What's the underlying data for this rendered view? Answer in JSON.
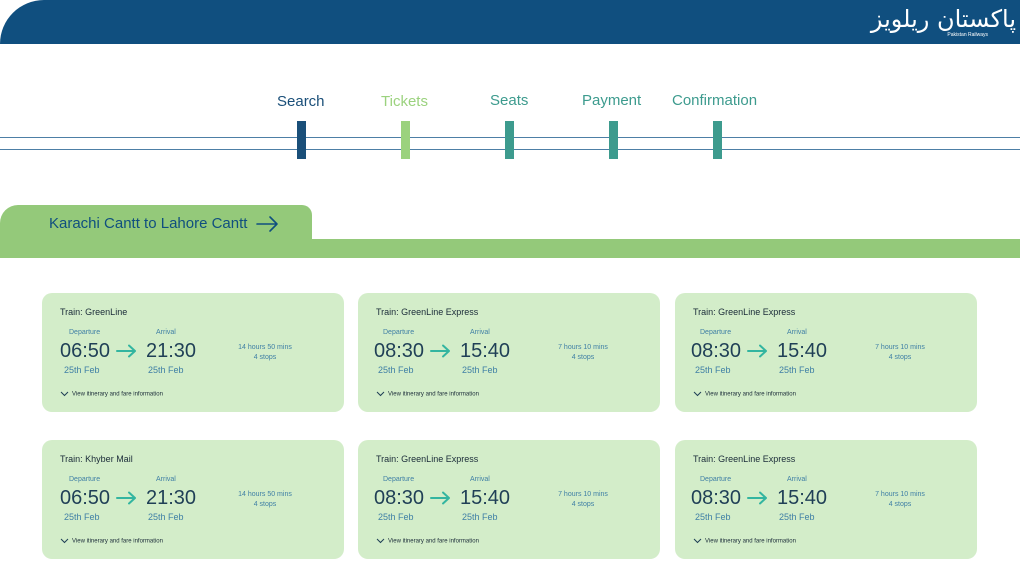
{
  "header": {
    "brand_urdu": "پاکستان ریلویز",
    "brand_english": "Pakistan Railways"
  },
  "steps": [
    {
      "label": "Search",
      "color": "#1a4f79"
    },
    {
      "label": "Tickets",
      "color": "#9bd27e"
    },
    {
      "label": "Seats",
      "color": "#3d9b8e"
    },
    {
      "label": "Payment",
      "color": "#3d9b8e"
    },
    {
      "label": "Confirmation",
      "color": "#3d9b8e"
    }
  ],
  "route": {
    "title": "Karachi Cantt to Lahore Cantt"
  },
  "labels": {
    "departure": "Departure",
    "arrival": "Arrival",
    "view": "View itinerary and fare information"
  },
  "trains": [
    {
      "name": "Train: GreenLine",
      "dep_time": "06:50",
      "dep_date": "25th Feb",
      "arr_time": "21:30",
      "arr_date": "25th Feb",
      "duration": "14 hours 50 mins",
      "stops": "4 stops"
    },
    {
      "name": "Train: GreenLine Express",
      "dep_time": "08:30",
      "dep_date": "25th Feb",
      "arr_time": "15:40",
      "arr_date": "25th Feb",
      "duration": "7 hours 10 mins",
      "stops": "4 stops"
    },
    {
      "name": "Train: GreenLine Express",
      "dep_time": "08:30",
      "dep_date": "25th Feb",
      "arr_time": "15:40",
      "arr_date": "25th Feb",
      "duration": "7 hours 10 mins",
      "stops": "4 stops"
    },
    {
      "name": "Train: Khyber Mail",
      "dep_time": "06:50",
      "dep_date": "25th Feb",
      "arr_time": "21:30",
      "arr_date": "25th Feb",
      "duration": "14 hours 50 mins",
      "stops": "4 stops"
    },
    {
      "name": "Train: GreenLine Express",
      "dep_time": "08:30",
      "dep_date": "25th Feb",
      "arr_time": "15:40",
      "arr_date": "25th Feb",
      "duration": "7 hours 10 mins",
      "stops": "4 stops"
    },
    {
      "name": "Train: GreenLine Express",
      "dep_time": "08:30",
      "dep_date": "25th Feb",
      "arr_time": "15:40",
      "arr_date": "25th Feb",
      "duration": "7 hours 10 mins",
      "stops": "4 stops"
    }
  ],
  "colors": {
    "header": "#104f7f",
    "route_band": "#94c97a",
    "card_bg": "#d3edc9",
    "arrow": "#33b5a0"
  }
}
